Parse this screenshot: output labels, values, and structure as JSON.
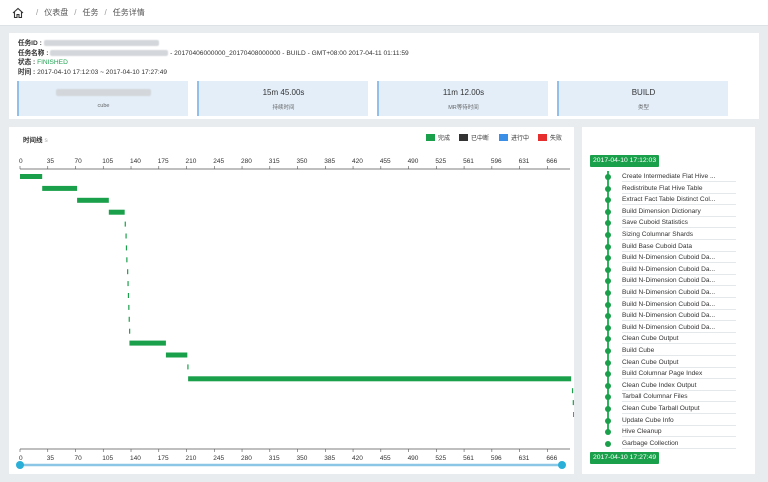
{
  "breadcrumb": {
    "items": [
      "仪表盘",
      "任务",
      "任务详情"
    ]
  },
  "job": {
    "id_label": "任务ID :",
    "name_label": "任务名称 :",
    "name_suffix": "- 20170406000000_20170408000000 - BUILD - GMT+08:00 2017-04-11 01:11:59",
    "status_label": "状态 :",
    "status_value": "FINISHED",
    "time_label": "时间 :",
    "time_value": "2017-04-10 17:12:03 ~ 2017-04-10 17:27:49"
  },
  "metrics": [
    {
      "value": "",
      "label": "cube"
    },
    {
      "value": "15m 45.00s",
      "label": "持续时间"
    },
    {
      "value": "11m 12.00s",
      "label": "MR等待时间"
    },
    {
      "value": "BUILD",
      "label": "类型"
    }
  ],
  "chart": {
    "title": "时间线",
    "subtitle": "s",
    "legend": [
      {
        "label": "完成",
        "color": "#1aa04b"
      },
      {
        "label": "已中断",
        "color": "#333333"
      },
      {
        "label": "进行中",
        "color": "#3b8fe6"
      },
      {
        "label": "失败",
        "color": "#e62e2e"
      }
    ]
  },
  "chart_data": {
    "type": "bar",
    "subtype": "gantt",
    "x_unit": "s",
    "xlim": [
      0,
      690
    ],
    "x_ticks": [
      "0",
      "35",
      "70",
      "105",
      "140",
      "175",
      "210",
      "245",
      "280",
      "315",
      "350",
      "385",
      "420",
      "455",
      "490",
      "525",
      "561",
      "596",
      "631",
      "666"
    ],
    "series_color": "#1aa04b",
    "tasks": [
      {
        "start": 0,
        "end": 28
      },
      {
        "start": 28,
        "end": 72
      },
      {
        "start": 72,
        "end": 112
      },
      {
        "start": 112,
        "end": 132
      },
      {
        "start": 132,
        "end": 133
      },
      {
        "start": 133,
        "end": 133.5
      },
      {
        "start": 133.5,
        "end": 134
      },
      {
        "start": 134,
        "end": 135
      },
      {
        "start": 135,
        "end": 135.5
      },
      {
        "start": 135.5,
        "end": 136
      },
      {
        "start": 136,
        "end": 136.5
      },
      {
        "start": 136.5,
        "end": 137
      },
      {
        "start": 137,
        "end": 137.5
      },
      {
        "start": 137.5,
        "end": 138
      },
      {
        "start": 138,
        "end": 184
      },
      {
        "start": 184,
        "end": 211
      },
      {
        "start": 211,
        "end": 212
      },
      {
        "start": 212,
        "end": 695
      },
      {
        "start": 696,
        "end": 697
      },
      {
        "start": 697,
        "end": 697.5
      },
      {
        "start": 697.5,
        "end": 702
      },
      {
        "start": 702,
        "end": 703
      }
    ]
  },
  "steps": {
    "start_time": "2017-04-10 17:12:03",
    "end_time": "2017-04-10 17:27:49",
    "items": [
      "Create Intermediate Flat Hive ...",
      "Redistribute Flat Hive Table",
      "Extract Fact Table Distinct Col...",
      "Build Dimension Dictionary",
      "Save Cuboid Statistics",
      "Sizing Columnar Shards",
      "Build Base Cuboid Data",
      "Build N-Dimension Cuboid Da...",
      "Build N-Dimension Cuboid Da...",
      "Build N-Dimension Cuboid Da...",
      "Build N-Dimension Cuboid Da...",
      "Build N-Dimension Cuboid Da...",
      "Build N-Dimension Cuboid Da...",
      "Build N-Dimension Cuboid Da...",
      "Clean Cube Output",
      "Build Cube",
      "Clean Cube Output",
      "Build Columnar Page Index",
      "Clean Cube Index Output",
      "Tarball Columnar Files",
      "Clean Cube Tarball Output",
      "Update Cube Info",
      "Hive Cleanup",
      "Garbage Collection"
    ]
  }
}
